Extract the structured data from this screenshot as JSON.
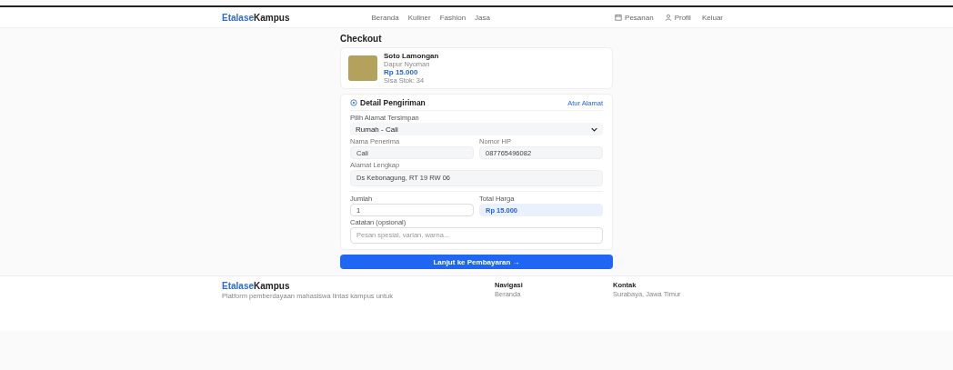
{
  "header": {
    "logo": {
      "first": "Etalase",
      "second": "Kampus"
    },
    "nav": [
      {
        "label": "Beranda"
      },
      {
        "label": "Kuliner"
      },
      {
        "label": "Fashion"
      },
      {
        "label": "Jasa"
      }
    ],
    "actions": [
      {
        "label": "Pesanan"
      },
      {
        "label": "Profil"
      },
      {
        "label": "Keluar"
      }
    ]
  },
  "page_title": "Checkout",
  "product": {
    "name": "Soto Lamongan",
    "seller": "Dapur Nyoman",
    "price": "Rp 15.000",
    "stock": "Sisa Stok: 34"
  },
  "shipping": {
    "title": "Detail Pengiriman",
    "link": "Atur Alamat",
    "saved_label": "Pilih Alamat Tersimpan",
    "saved_value": "Rumah - Cali",
    "fields": [
      {
        "label": "Nama Penerima",
        "value": "Cali",
        "kind": "input"
      },
      {
        "label": "Nomor HP",
        "value": "087765496082",
        "kind": "input"
      }
    ],
    "address_label": "Alamat Lengkap",
    "address_value": "Ds Kebonagung, RT 19 RW 06",
    "qty_label": "Jumlah",
    "qty_value": "1",
    "total_label": "Total Harga",
    "total_value": "Rp 15.000",
    "note_label": "Catatan (opsional)",
    "note_placeholder": "Pesan spesial, varian, warna..."
  },
  "submit": "Lanjut ke Pembayaran →",
  "footer": {
    "logo": {
      "first": "Etalase",
      "second": "Kampus"
    },
    "tagline": "Platform pemberdayaan mahasiswa lintas kampus untuk",
    "columns": [
      {
        "title": "Navigasi",
        "items": [
          "Beranda"
        ]
      },
      {
        "title": "Kontak",
        "items": [
          "Surabaya, Jawa Timur"
        ]
      }
    ]
  }
}
